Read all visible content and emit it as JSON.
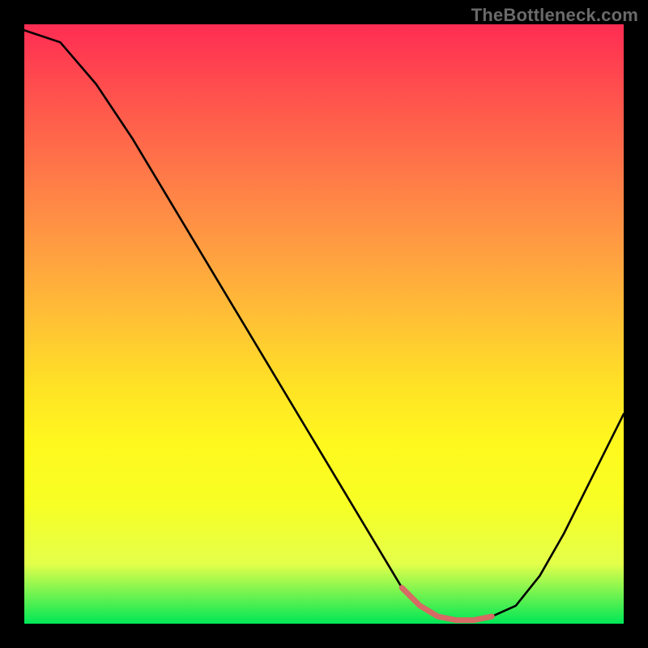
{
  "watermark": "TheBottleneck.com",
  "colors": {
    "gradient_top": "#ff2c53",
    "gradient_mid": "#ffe126",
    "gradient_bottom": "#00e756",
    "curve": "#000000",
    "highlight": "#d66a64",
    "background": "#000000"
  },
  "chart_data": {
    "type": "line",
    "title": "",
    "xlabel": "",
    "ylabel": "",
    "xlim": [
      0,
      100
    ],
    "ylim": [
      0,
      100
    ],
    "x": [
      0,
      6,
      12,
      18,
      24,
      30,
      36,
      42,
      48,
      54,
      60,
      63,
      66,
      69,
      72,
      75,
      78,
      82,
      86,
      90,
      94,
      98,
      100
    ],
    "values": [
      99,
      97,
      90,
      81,
      71,
      61,
      51,
      41,
      31,
      21,
      11,
      6,
      3,
      1.2,
      0.6,
      0.6,
      1.2,
      3,
      8,
      15,
      23,
      31,
      35
    ],
    "highlight_segment": {
      "x": [
        63,
        66,
        69,
        72,
        75,
        78
      ],
      "values": [
        6,
        3,
        1.2,
        0.6,
        0.6,
        1.2
      ]
    },
    "annotations": []
  }
}
